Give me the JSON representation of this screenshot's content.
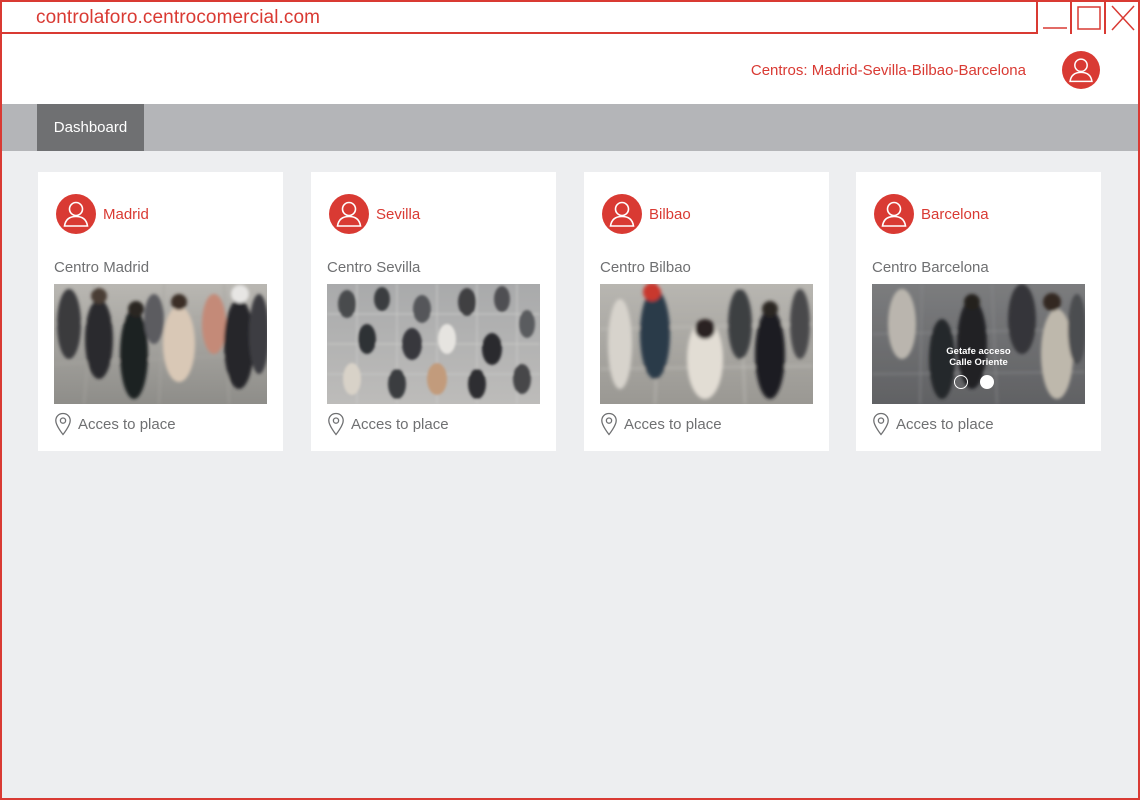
{
  "window": {
    "url": "controlaforo.centrocomercial.com",
    "controls": [
      "minimize",
      "maximize",
      "close"
    ]
  },
  "header": {
    "centros": "Centros: Madrid-Sevilla-Bilbao-Barcelona",
    "avatar_icon": "user-avatar-icon"
  },
  "nav": {
    "tabs": [
      {
        "label": "Dashboard",
        "active": true
      }
    ]
  },
  "cards": [
    {
      "title": "Madrid",
      "subtitle": "Centro Madrid",
      "access": "Acces to place"
    },
    {
      "title": "Sevilla",
      "subtitle": "Centro Sevilla",
      "access": "Acces to place"
    },
    {
      "title": "Bilbao",
      "subtitle": "Centro Bilbao",
      "access": "Acces to place"
    },
    {
      "title": "Barcelona",
      "subtitle": "Centro Barcelona",
      "access": "Acces to place",
      "overlay": {
        "line1": "Getafe acceso",
        "line2": "Calle Oriente"
      },
      "carousel": {
        "count": 2,
        "active_index": 1
      }
    }
  ],
  "colors": {
    "accent": "#d93a33",
    "navbar": "#b4b5b8",
    "tab_active": "#6f7072",
    "background": "#edeef0",
    "text_muted": "#6f7072"
  }
}
